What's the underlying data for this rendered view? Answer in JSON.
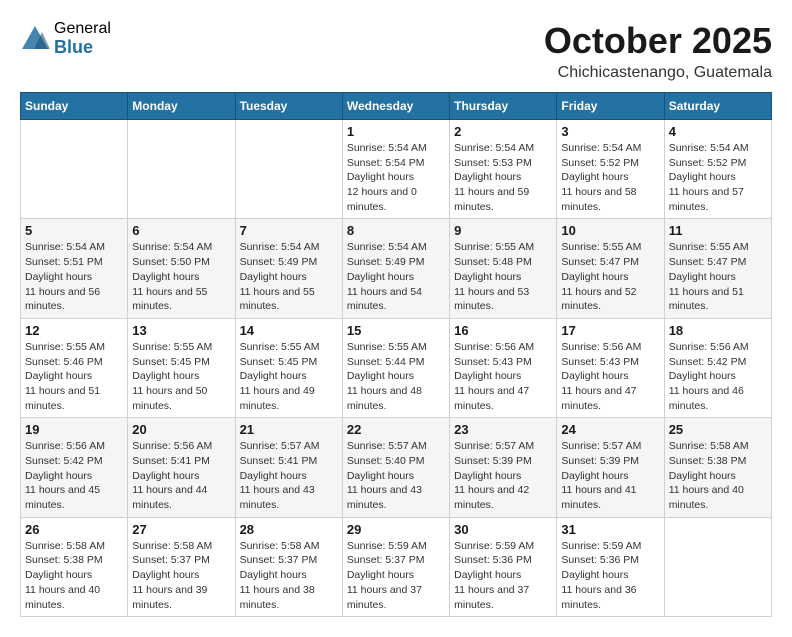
{
  "logo": {
    "general": "General",
    "blue": "Blue"
  },
  "header": {
    "month": "October 2025",
    "location": "Chichicastenango, Guatemala"
  },
  "weekdays": [
    "Sunday",
    "Monday",
    "Tuesday",
    "Wednesday",
    "Thursday",
    "Friday",
    "Saturday"
  ],
  "weeks": [
    [
      {
        "day": "",
        "info": ""
      },
      {
        "day": "",
        "info": ""
      },
      {
        "day": "",
        "info": ""
      },
      {
        "day": "1",
        "sunrise": "5:54 AM",
        "sunset": "5:54 PM",
        "daylight": "12 hours and 0 minutes."
      },
      {
        "day": "2",
        "sunrise": "5:54 AM",
        "sunset": "5:53 PM",
        "daylight": "11 hours and 59 minutes."
      },
      {
        "day": "3",
        "sunrise": "5:54 AM",
        "sunset": "5:52 PM",
        "daylight": "11 hours and 58 minutes."
      },
      {
        "day": "4",
        "sunrise": "5:54 AM",
        "sunset": "5:52 PM",
        "daylight": "11 hours and 57 minutes."
      }
    ],
    [
      {
        "day": "5",
        "sunrise": "5:54 AM",
        "sunset": "5:51 PM",
        "daylight": "11 hours and 56 minutes."
      },
      {
        "day": "6",
        "sunrise": "5:54 AM",
        "sunset": "5:50 PM",
        "daylight": "11 hours and 55 minutes."
      },
      {
        "day": "7",
        "sunrise": "5:54 AM",
        "sunset": "5:49 PM",
        "daylight": "11 hours and 55 minutes."
      },
      {
        "day": "8",
        "sunrise": "5:54 AM",
        "sunset": "5:49 PM",
        "daylight": "11 hours and 54 minutes."
      },
      {
        "day": "9",
        "sunrise": "5:55 AM",
        "sunset": "5:48 PM",
        "daylight": "11 hours and 53 minutes."
      },
      {
        "day": "10",
        "sunrise": "5:55 AM",
        "sunset": "5:47 PM",
        "daylight": "11 hours and 52 minutes."
      },
      {
        "day": "11",
        "sunrise": "5:55 AM",
        "sunset": "5:47 PM",
        "daylight": "11 hours and 51 minutes."
      }
    ],
    [
      {
        "day": "12",
        "sunrise": "5:55 AM",
        "sunset": "5:46 PM",
        "daylight": "11 hours and 51 minutes."
      },
      {
        "day": "13",
        "sunrise": "5:55 AM",
        "sunset": "5:45 PM",
        "daylight": "11 hours and 50 minutes."
      },
      {
        "day": "14",
        "sunrise": "5:55 AM",
        "sunset": "5:45 PM",
        "daylight": "11 hours and 49 minutes."
      },
      {
        "day": "15",
        "sunrise": "5:55 AM",
        "sunset": "5:44 PM",
        "daylight": "11 hours and 48 minutes."
      },
      {
        "day": "16",
        "sunrise": "5:56 AM",
        "sunset": "5:43 PM",
        "daylight": "11 hours and 47 minutes."
      },
      {
        "day": "17",
        "sunrise": "5:56 AM",
        "sunset": "5:43 PM",
        "daylight": "11 hours and 47 minutes."
      },
      {
        "day": "18",
        "sunrise": "5:56 AM",
        "sunset": "5:42 PM",
        "daylight": "11 hours and 46 minutes."
      }
    ],
    [
      {
        "day": "19",
        "sunrise": "5:56 AM",
        "sunset": "5:42 PM",
        "daylight": "11 hours and 45 minutes."
      },
      {
        "day": "20",
        "sunrise": "5:56 AM",
        "sunset": "5:41 PM",
        "daylight": "11 hours and 44 minutes."
      },
      {
        "day": "21",
        "sunrise": "5:57 AM",
        "sunset": "5:41 PM",
        "daylight": "11 hours and 43 minutes."
      },
      {
        "day": "22",
        "sunrise": "5:57 AM",
        "sunset": "5:40 PM",
        "daylight": "11 hours and 43 minutes."
      },
      {
        "day": "23",
        "sunrise": "5:57 AM",
        "sunset": "5:39 PM",
        "daylight": "11 hours and 42 minutes."
      },
      {
        "day": "24",
        "sunrise": "5:57 AM",
        "sunset": "5:39 PM",
        "daylight": "11 hours and 41 minutes."
      },
      {
        "day": "25",
        "sunrise": "5:58 AM",
        "sunset": "5:38 PM",
        "daylight": "11 hours and 40 minutes."
      }
    ],
    [
      {
        "day": "26",
        "sunrise": "5:58 AM",
        "sunset": "5:38 PM",
        "daylight": "11 hours and 40 minutes."
      },
      {
        "day": "27",
        "sunrise": "5:58 AM",
        "sunset": "5:37 PM",
        "daylight": "11 hours and 39 minutes."
      },
      {
        "day": "28",
        "sunrise": "5:58 AM",
        "sunset": "5:37 PM",
        "daylight": "11 hours and 38 minutes."
      },
      {
        "day": "29",
        "sunrise": "5:59 AM",
        "sunset": "5:37 PM",
        "daylight": "11 hours and 37 minutes."
      },
      {
        "day": "30",
        "sunrise": "5:59 AM",
        "sunset": "5:36 PM",
        "daylight": "11 hours and 37 minutes."
      },
      {
        "day": "31",
        "sunrise": "5:59 AM",
        "sunset": "5:36 PM",
        "daylight": "11 hours and 36 minutes."
      },
      {
        "day": "",
        "info": ""
      }
    ]
  ],
  "labels": {
    "sunrise": "Sunrise:",
    "sunset": "Sunset:",
    "daylight": "Daylight hours"
  }
}
